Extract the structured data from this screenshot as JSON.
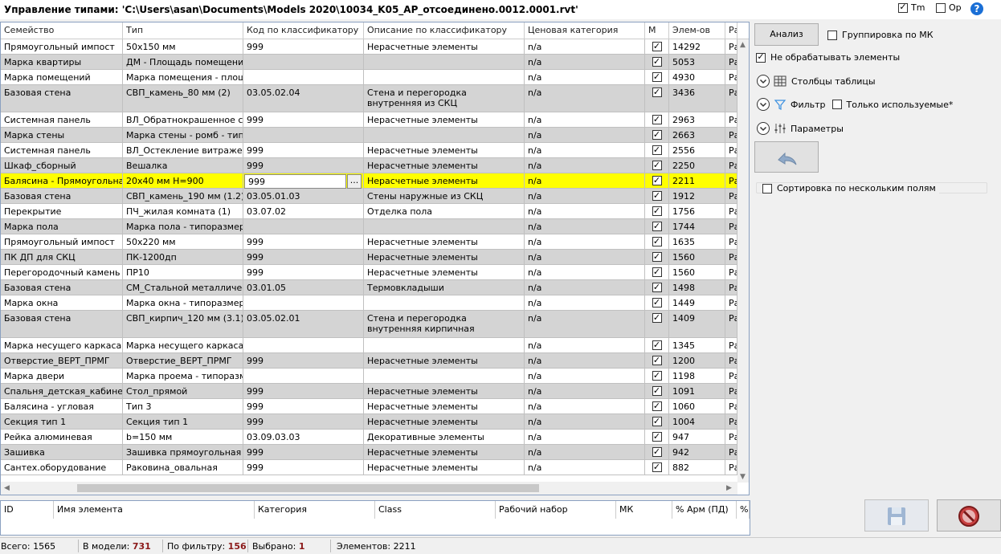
{
  "window": {
    "title": "Управление типами: 'C:\\Users\\asan\\Documents\\Models 2020\\10034_K05_АР_отсоединено.0012.0001.rvt'"
  },
  "topbar": {
    "tm_label": "Tm",
    "tm_checked": true,
    "op_label": "Op",
    "op_checked": false,
    "help_label": "?"
  },
  "grid": {
    "columns": [
      "Семейство",
      "Тип",
      "Код по классификатору",
      "Описание по классификатору",
      "Ценовая категория",
      "М",
      "Элем-ов",
      "Ра"
    ],
    "rows": [
      {
        "family": "Прямоугольный импост",
        "type": "50x150 мм",
        "code": "999",
        "desc": "Нерасчетные элементы",
        "price": "n/a",
        "count": "14292",
        "extra": "Ра"
      },
      {
        "family": "Марка квартиры",
        "type": "ДМ - Площадь помещения",
        "code": "",
        "desc": "",
        "price": "n/a",
        "count": "5053",
        "extra": "Ра"
      },
      {
        "family": "Марка помещений",
        "type": "Марка помещения - площ",
        "code": "",
        "desc": "",
        "price": "n/a",
        "count": "4930",
        "extra": "Ра"
      },
      {
        "family": "Базовая стена",
        "type": "СВП_камень_80 мм (2)",
        "code": "03.05.02.04",
        "desc": "Стена и перегородка внутренняя из СКЦ",
        "price": "n/a",
        "count": "3436",
        "extra": "Ра"
      },
      {
        "family": "Системная панель",
        "type": "ВЛ_Обратнокрашенное сте",
        "code": "999",
        "desc": "Нерасчетные элементы",
        "price": "n/a",
        "count": "2963",
        "extra": "Ра"
      },
      {
        "family": "Марка стены",
        "type": "Марка стены - ромб - типс",
        "code": "",
        "desc": "",
        "price": "n/a",
        "count": "2663",
        "extra": "Ра"
      },
      {
        "family": "Системная панель",
        "type": "ВЛ_Остекление витражей",
        "code": "999",
        "desc": "Нерасчетные элементы",
        "price": "n/a",
        "count": "2556",
        "extra": "Ра"
      },
      {
        "family": "Шкаф_сборный",
        "type": "Вешалка",
        "code": "999",
        "desc": "Нерасчетные элементы",
        "price": "n/a",
        "count": "2250",
        "extra": "Ра"
      },
      {
        "family": "Балясина - Прямоугольная",
        "type": "20x40 мм H=900",
        "code": "999",
        "desc": "Нерасчетные элементы",
        "price": "n/a",
        "count": "2211",
        "extra": "Ра"
      },
      {
        "family": "Базовая стена",
        "type": "СВП_камень_190 мм (1.2)",
        "code": "03.05.01.03",
        "desc": "Стены наружные из СКЦ",
        "price": "n/a",
        "count": "1912",
        "extra": "Ра"
      },
      {
        "family": "Перекрытие",
        "type": "ПЧ_жилая комната (1)",
        "code": "03.07.02",
        "desc": "Отделка пола",
        "price": "n/a",
        "count": "1756",
        "extra": "Ра"
      },
      {
        "family": "Марка пола",
        "type": "Марка пола - типоразмер",
        "code": "",
        "desc": "",
        "price": "n/a",
        "count": "1744",
        "extra": "Ра"
      },
      {
        "family": "Прямоугольный импост",
        "type": "50x220 мм",
        "code": "999",
        "desc": "Нерасчетные элементы",
        "price": "n/a",
        "count": "1635",
        "extra": "Ра"
      },
      {
        "family": "ПК ДП для СКЦ",
        "type": "ПК-1200дп",
        "code": "999",
        "desc": "Нерасчетные элементы",
        "price": "n/a",
        "count": "1560",
        "extra": "Ра"
      },
      {
        "family": "Перегородочный камень г",
        "type": "ПР10",
        "code": "999",
        "desc": "Нерасчетные элементы",
        "price": "n/a",
        "count": "1560",
        "extra": "Ра"
      },
      {
        "family": "Базовая стена",
        "type": "СМ_Стальной металлическ",
        "code": "03.01.05",
        "desc": "Термовкладыши",
        "price": "n/a",
        "count": "1498",
        "extra": "Ра"
      },
      {
        "family": "Марка окна",
        "type": "Марка окна - типоразмер",
        "code": "",
        "desc": "",
        "price": "n/a",
        "count": "1449",
        "extra": "Ра"
      },
      {
        "family": "Базовая стена",
        "type": "СВП_кирпич_120 мм (3.1)",
        "code": "03.05.02.01",
        "desc": "Стена и перегородка  внутренняя кирпичная",
        "price": "n/a",
        "count": "1409",
        "extra": "Ра"
      },
      {
        "family": "Марка несущего каркаса",
        "type": "Марка несущего каркаса -",
        "code": "",
        "desc": "",
        "price": "n/a",
        "count": "1345",
        "extra": "Ра"
      },
      {
        "family": "Отверстие_ВЕРТ_ПРМГ",
        "type": "Отверстие_ВЕРТ_ПРМГ",
        "code": "999",
        "desc": "Нерасчетные элементы",
        "price": "n/a",
        "count": "1200",
        "extra": "Ра"
      },
      {
        "family": "Марка двери",
        "type": "Марка проема - типоразм",
        "code": "",
        "desc": "",
        "price": "n/a",
        "count": "1198",
        "extra": "Ра"
      },
      {
        "family": "Спальня_детская_кабинет",
        "type": "Стол_прямой",
        "code": "999",
        "desc": "Нерасчетные элементы",
        "price": "n/a",
        "count": "1091",
        "extra": "Ра"
      },
      {
        "family": "Балясина - угловая",
        "type": "Тип 3",
        "code": "999",
        "desc": "Нерасчетные элементы",
        "price": "n/a",
        "count": "1060",
        "extra": "Ра"
      },
      {
        "family": "Секция тип 1",
        "type": "Секция тип 1",
        "code": "999",
        "desc": "Нерасчетные элементы",
        "price": "n/a",
        "count": "1004",
        "extra": "Ра"
      },
      {
        "family": "Рейка алюминевая",
        "type": "b=150 мм",
        "code": "03.09.03.03",
        "desc": "Декоративные элементы фасадов",
        "price": "n/a",
        "count": "947",
        "extra": "Ра"
      },
      {
        "family": "Зашивка",
        "type": "Зашивка прямоугольная",
        "code": "999",
        "desc": "Нерасчетные элементы",
        "price": "n/a",
        "count": "942",
        "extra": "Ра"
      },
      {
        "family": "Сантех.оборудование",
        "type": "Раковина_овальная",
        "code": "999",
        "desc": "Нерасчетные элементы",
        "price": "n/a",
        "count": "882",
        "extra": "Ра"
      }
    ],
    "selected_row": 8,
    "edit_value": "999",
    "edit_button": "..."
  },
  "side": {
    "analyze_button": "Анализ",
    "group_mk_label": "Группировка по МК",
    "group_mk_checked": false,
    "dont_process_label": "Не обрабатывать элементы",
    "dont_process_checked": true,
    "table_columns_label": "Столбцы таблицы",
    "filter_label": "Фильтр",
    "only_used_label": "Только используемые*",
    "only_used_checked": false,
    "params_label": "Параметры",
    "multi_sort_label": "Сортировка по нескольким полям",
    "multi_sort_checked": false
  },
  "bottom_grid": {
    "columns": [
      "ID",
      "Имя элемента",
      "Категория",
      "Class",
      "Рабочий набор",
      "МК",
      "% Арм (ПД)",
      "%"
    ]
  },
  "status": {
    "total_label": "Всего:",
    "total_value": "1565",
    "in_model_label": "В модели:",
    "in_model_value": "731",
    "by_filter_label": "По фильтру:",
    "by_filter_value": "156",
    "selected_label": "Выбрано:",
    "selected_value": "1",
    "elements_label": "Элементов:",
    "elements_value": "2211"
  },
  "colors": {
    "selected_row": "#ffff00",
    "alt_row": "#d4d4d4",
    "accent": "#1a6fd6",
    "status_value": "#8b1a1a",
    "cancel": "#b22222"
  }
}
